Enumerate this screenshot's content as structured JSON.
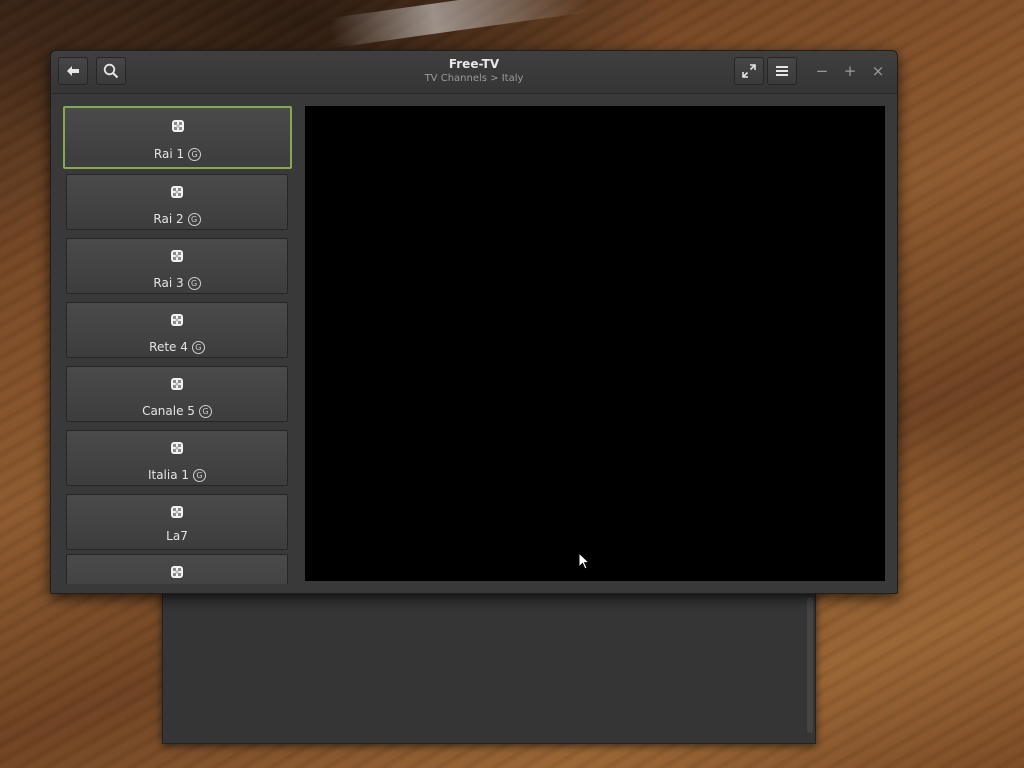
{
  "window": {
    "title": "Free-TV",
    "subtitle": "TV Channels > Italy",
    "controls": {
      "minimize_glyph": "−",
      "maximize_glyph": "+",
      "close_glyph": "×"
    }
  },
  "header": {
    "back_icon": "back-arrow-icon",
    "search_icon": "search-icon",
    "fullscreen_icon": "fullscreen-expand-icon",
    "menu_icon": "hamburger-menu-icon"
  },
  "channels": [
    {
      "name": "Rai 1",
      "badge": "G",
      "selected": true
    },
    {
      "name": "Rai 2",
      "badge": "G"
    },
    {
      "name": "Rai 3",
      "badge": "G"
    },
    {
      "name": "Rete 4",
      "badge": "G"
    },
    {
      "name": "Canale 5",
      "badge": "G"
    },
    {
      "name": "Italia 1",
      "badge": "G"
    },
    {
      "name": "La7",
      "badge": ""
    },
    {
      "name": "",
      "badge": ""
    }
  ],
  "colors": {
    "selected_border": "#8aa654",
    "window_bg": "#393939",
    "video_bg": "#000000"
  }
}
